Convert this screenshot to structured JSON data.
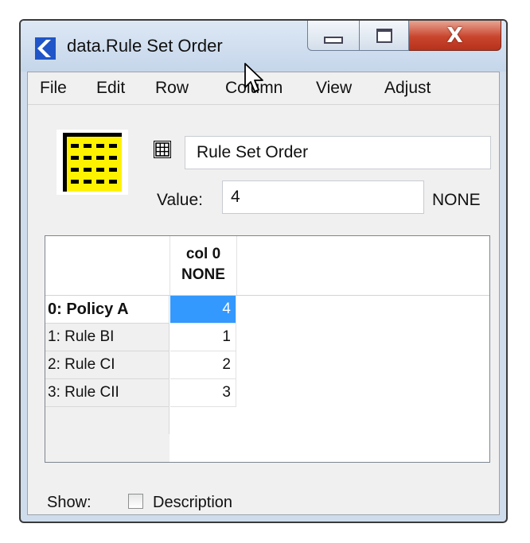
{
  "window": {
    "title": "data.Rule Set Order",
    "controls": {
      "minimize": "minimize",
      "maximize": "maximize",
      "close": "X"
    }
  },
  "menu": [
    "File",
    "Edit",
    "Row",
    "Column",
    "View",
    "Adjust"
  ],
  "slot": {
    "name": "Rule Set Order",
    "value_label": "Value:",
    "value": "4",
    "unit": "NONE"
  },
  "table": {
    "columns": [
      {
        "name": "col 0",
        "unit": "NONE"
      }
    ],
    "rows": [
      {
        "label": "0: Policy A",
        "value": "4"
      },
      {
        "label": "1: Rule BI",
        "value": "1"
      },
      {
        "label": "2: Rule CI",
        "value": "2"
      },
      {
        "label": "3: Rule CII",
        "value": "3"
      }
    ],
    "selected_row": 0
  },
  "footer": {
    "show_label": "Show:",
    "description_label": "Description",
    "description_checked": false
  },
  "icons": {
    "app": "app-logo-icon",
    "table": "table-slot-icon",
    "grid": "grid-icon",
    "cursor": "mouse-cursor"
  },
  "colors": {
    "selection": "#3399ff",
    "close_button": "#c9452d",
    "titlebar": "#cfdcec"
  }
}
